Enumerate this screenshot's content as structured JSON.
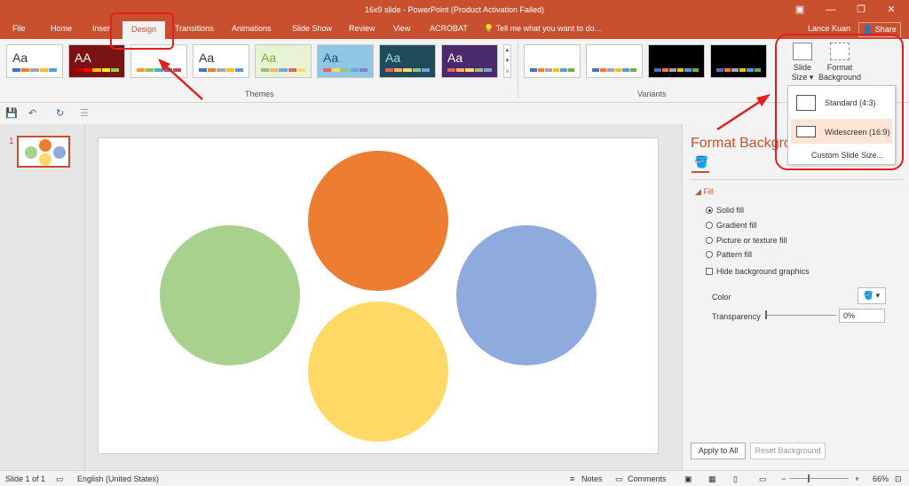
{
  "titlebar": {
    "title": "16x9 slide - PowerPoint (Product Activation Failed)",
    "user": "Lance Kuan",
    "share": "Share"
  },
  "tabs": [
    {
      "label": "File"
    },
    {
      "label": "Home"
    },
    {
      "label": "Inser"
    },
    {
      "label": "Design"
    },
    {
      "label": "Transitions"
    },
    {
      "label": "Animations"
    },
    {
      "label": "Slide Show"
    },
    {
      "label": "Review"
    },
    {
      "label": "View"
    },
    {
      "label": "ACROBAT"
    }
  ],
  "tellme": "Tell me what you want to do...",
  "themes": {
    "label": "Themes",
    "items": [
      {
        "aa": "Aa",
        "bg": "#ffffff",
        "fg": "#333333"
      },
      {
        "aa": "AA",
        "bg": "#7a1414",
        "fg": "#ffffff"
      },
      {
        "aa": "",
        "bg": "#ffffff",
        "fg": "#333333"
      },
      {
        "aa": "Aa",
        "bg": "#ffffff",
        "fg": "#333333"
      },
      {
        "aa": "Aa",
        "bg": "#e8f3d6",
        "fg": "#7aa832"
      },
      {
        "aa": "Aa",
        "bg": "#8fc6e4",
        "fg": "#1f4f6b"
      },
      {
        "aa": "Aa",
        "bg": "#1f4b5a",
        "fg": "#9ee0d8"
      },
      {
        "aa": "Aa",
        "bg": "#4b2a6b",
        "fg": "#ffffff"
      }
    ]
  },
  "variants": {
    "label": "Variants",
    "items": [
      {
        "bg": "#ffffff"
      },
      {
        "bg": "#ffffff"
      },
      {
        "bg": "#000000"
      },
      {
        "bg": "#000000"
      }
    ]
  },
  "ribbon_buttons": {
    "slide_size_1": "Slide",
    "slide_size_2": "Size ▾",
    "format_bg_1": "Format",
    "format_bg_2": "Background"
  },
  "slide_size_menu": {
    "standard": "Standard (4:3)",
    "widescreen": "Widescreen (16:9)",
    "custom": "Custom Slide Size..."
  },
  "thumbnails": {
    "slide_number": "1"
  },
  "format_panel": {
    "title": "Format Backgrou",
    "section": "Fill",
    "options": {
      "solid": "Solid fill",
      "gradient": "Gradient fill",
      "picture": "Picture or texture fill",
      "pattern": "Pattern fill",
      "hide": "Hide background graphics"
    },
    "color_label": "Color",
    "transparency_label": "Transparency",
    "transparency_value": "0%",
    "apply_all": "Apply to All",
    "reset": "Reset Background"
  },
  "slide_shapes": {
    "colors": {
      "orange": "#ed7d31",
      "green": "#a9d18e",
      "blue": "#8faadc",
      "yellow": "#ffd966"
    }
  },
  "statusbar": {
    "slide": "Slide 1 of 1",
    "language": "English (United States)",
    "notes": "Notes",
    "comments": "Comments",
    "zoom": "66%"
  },
  "accent": "#c9502e",
  "annotation_color": "#e02020"
}
